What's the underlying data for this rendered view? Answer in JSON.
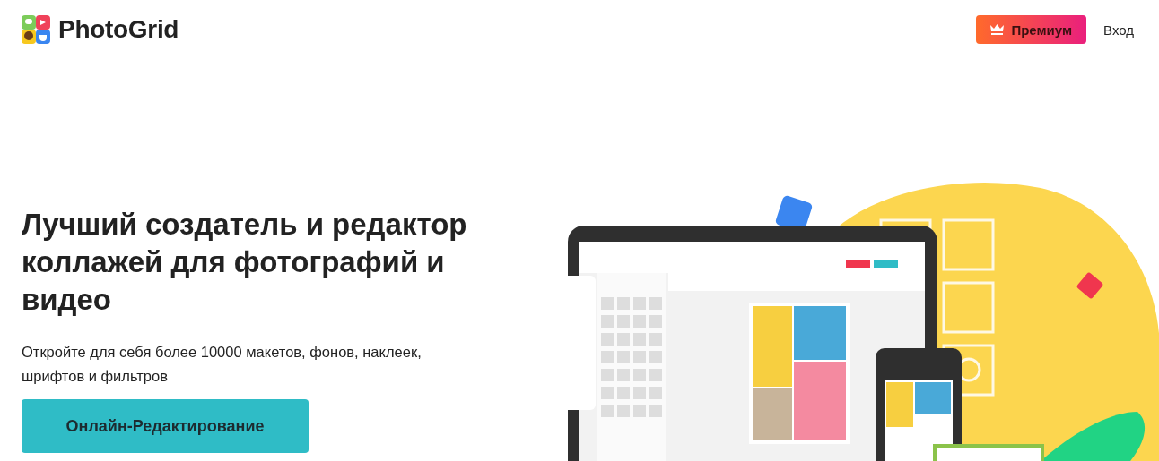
{
  "header": {
    "logo_text": "PhotoGrid",
    "premium_button": "Премиум",
    "login_link": "Вход"
  },
  "hero": {
    "title": "Лучший создатель и редактор коллажей для фотографий и видео",
    "subtitle": "Откройте для себя более 10000 макетов, фонов, наклеек, шрифтов и фильтров",
    "cta_button": "Онлайн-Редактирование"
  }
}
